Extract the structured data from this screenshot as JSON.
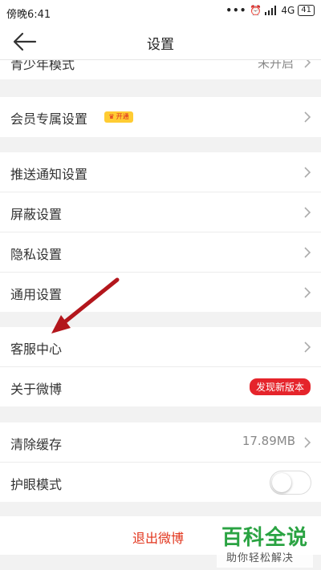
{
  "status_bar": {
    "time": "傍晚6:41",
    "network": "4G",
    "battery": "41"
  },
  "header": {
    "title": "设置"
  },
  "rows": {
    "teen_mode": {
      "label": "青少年模式",
      "value": "未开启"
    },
    "vip": {
      "label": "会员专属设置",
      "badge": "开通"
    },
    "push": {
      "label": "推送通知设置"
    },
    "block": {
      "label": "屏蔽设置"
    },
    "privacy": {
      "label": "隐私设置"
    },
    "general": {
      "label": "通用设置"
    },
    "support": {
      "label": "客服中心"
    },
    "about": {
      "label": "关于微博",
      "badge": "发现新版本"
    },
    "cache": {
      "label": "清除缓存",
      "value": "17.89MB"
    },
    "eye_care": {
      "label": "护眼模式",
      "enabled": false
    }
  },
  "logout": {
    "label": "退出微博"
  },
  "watermark": {
    "title": "百科全说",
    "subtitle": "助你轻松解决"
  },
  "colors": {
    "accent_red": "#e5242b",
    "logout_red": "#e2361e",
    "watermark_green": "#2aa342",
    "annotation_arrow": "#b3161c"
  }
}
